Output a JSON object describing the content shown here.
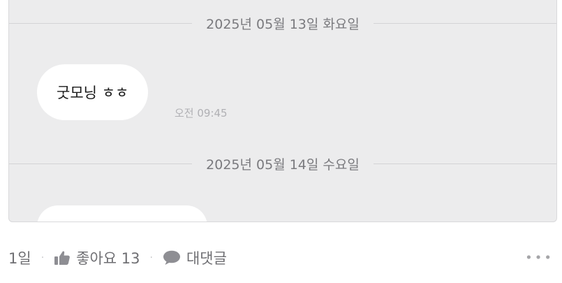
{
  "chat": {
    "date_separators": [
      "2025년 05월 13일 화요일",
      "2025년 05월 14일 수요일"
    ],
    "messages": [
      {
        "text": "굿모닝 ㅎㅎ",
        "time": "오전 09:45"
      },
      {
        "text": ""
      }
    ]
  },
  "footer": {
    "age": "1일",
    "like_label": "좋아요 13",
    "reply_label": "대댓글",
    "more_label": "•••"
  },
  "icons": {
    "like": "thumbs-up-icon",
    "reply": "speech-bubble-icon",
    "more": "more-dots-icon"
  },
  "colors": {
    "chat_background": "#ececed",
    "bubble": "#ffffff",
    "icon_gray": "#8e8e93"
  }
}
